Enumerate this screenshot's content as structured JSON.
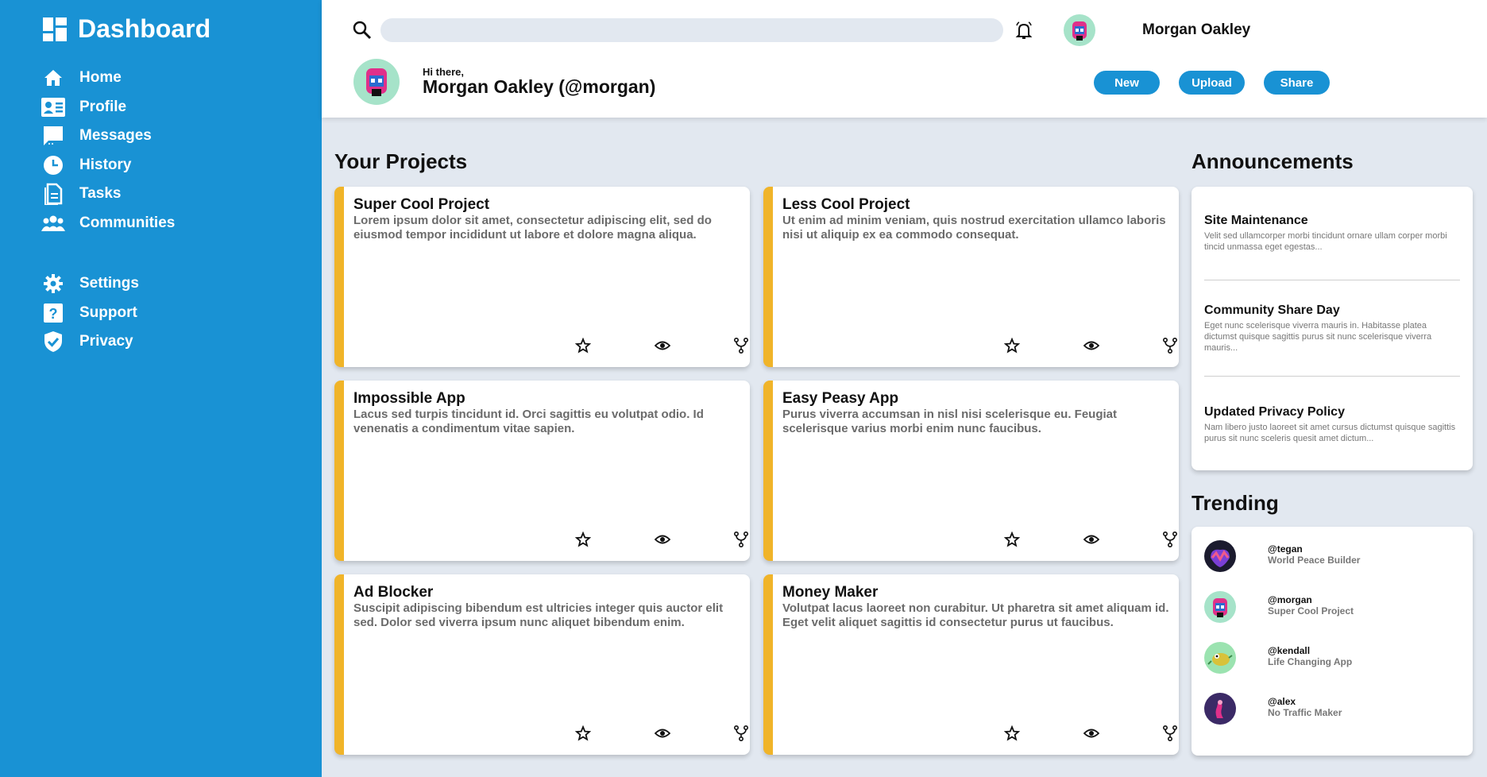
{
  "sidebar": {
    "brand": "Dashboard",
    "items": [
      {
        "label": "Home",
        "icon": "home-icon"
      },
      {
        "label": "Profile",
        "icon": "profile-card-icon"
      },
      {
        "label": "Messages",
        "icon": "message-icon"
      },
      {
        "label": "History",
        "icon": "clock-icon"
      },
      {
        "label": "Tasks",
        "icon": "document-icon"
      },
      {
        "label": "Communities",
        "icon": "people-icon"
      }
    ],
    "secondary": [
      {
        "label": "Settings",
        "icon": "gear-icon"
      },
      {
        "label": "Support",
        "icon": "help-icon"
      },
      {
        "label": "Privacy",
        "icon": "shield-icon"
      }
    ]
  },
  "header": {
    "search_placeholder": "",
    "user_name": "Morgan Oakley",
    "greeting": "Hi there,",
    "greeting_name": "Morgan Oakley (@morgan)",
    "buttons": {
      "new": "New",
      "upload": "Upload",
      "share": "Share"
    }
  },
  "projects": {
    "title": "Your Projects",
    "items": [
      {
        "title": "Super Cool Project",
        "desc": "Lorem ipsum dolor sit amet, consectetur adipiscing elit, sed do eiusmod tempor incididunt ut labore et dolore magna aliqua."
      },
      {
        "title": "Less Cool Project",
        "desc": "Ut enim ad minim veniam, quis nostrud exercitation ullamco laboris nisi ut aliquip ex ea commodo consequat."
      },
      {
        "title": "Impossible App",
        "desc": "Lacus sed turpis tincidunt id. Orci sagittis eu volutpat odio. Id venenatis a condimentum vitae sapien."
      },
      {
        "title": "Easy Peasy App",
        "desc": "Purus viverra accumsan in nisl nisi scelerisque eu. Feugiat scelerisque varius morbi enim nunc faucibus."
      },
      {
        "title": "Ad Blocker",
        "desc": "Suscipit adipiscing bibendum est ultricies integer quis auctor elit sed. Dolor sed viverra ipsum nunc aliquet bibendum enim."
      },
      {
        "title": "Money Maker",
        "desc": "Volutpat lacus laoreet non curabitur. Ut pharetra sit amet aliquam id. Eget velit aliquet sagittis id consectetur purus ut faucibus."
      }
    ]
  },
  "announcements": {
    "title": "Announcements",
    "items": [
      {
        "title": "Site Maintenance",
        "body": "Velit sed ullamcorper morbi tincidunt ornare ullam corper morbi tincid unmassa eget egestas..."
      },
      {
        "title": "Community Share Day",
        "body": "Eget nunc scelerisque viverra mauris in. Habitasse platea dictumst quisque sagittis purus sit nunc scelerisque viverra mauris..."
      },
      {
        "title": "Updated Privacy Policy",
        "body": "Nam libero justo laoreet sit amet cursus dictumst quisque sagittis purus sit nunc sceleris quesit amet dictum..."
      }
    ]
  },
  "trending": {
    "title": "Trending",
    "items": [
      {
        "handle": "@tegan",
        "project": "World Peace Builder"
      },
      {
        "handle": "@morgan",
        "project": "Super Cool Project"
      },
      {
        "handle": "@kendall",
        "project": "Life Changing App"
      },
      {
        "handle": "@alex",
        "project": "No Traffic Maker"
      }
    ]
  },
  "colors": {
    "sidebar": "#1992d4",
    "accent": "#f0b429",
    "background": "#e2e8f0"
  }
}
